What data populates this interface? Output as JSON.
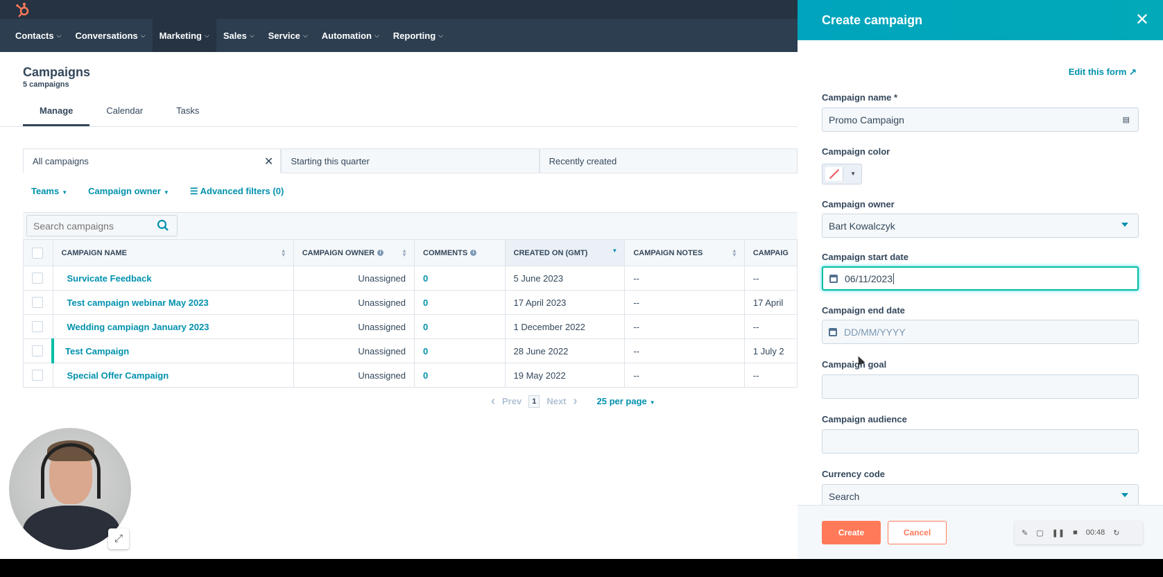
{
  "nav": {
    "items": [
      {
        "label": "Contacts"
      },
      {
        "label": "Conversations"
      },
      {
        "label": "Marketing"
      },
      {
        "label": "Sales"
      },
      {
        "label": "Service"
      },
      {
        "label": "Automation"
      },
      {
        "label": "Reporting"
      }
    ]
  },
  "header": {
    "title": "Campaigns",
    "subtitle": "5 campaigns"
  },
  "tabs": [
    {
      "label": "Manage"
    },
    {
      "label": "Calendar"
    },
    {
      "label": "Tasks"
    }
  ],
  "views": [
    {
      "label": "All campaigns"
    },
    {
      "label": "Starting this quarter"
    },
    {
      "label": "Recently created"
    }
  ],
  "filters": {
    "teams": "Teams",
    "owner": "Campaign owner",
    "advanced": "Advanced filters (0)"
  },
  "search": {
    "placeholder": "Search campaigns"
  },
  "table": {
    "headers": [
      "CAMPAIGN NAME",
      "CAMPAIGN OWNER",
      "COMMENTS",
      "CREATED ON (GMT)",
      "CAMPAIGN NOTES",
      "CAMPAIG"
    ],
    "rows": [
      {
        "name": "Survicate Feedback",
        "owner": "Unassigned",
        "comments": "0",
        "created": "5 June 2023",
        "notes": "--",
        "extra": "--"
      },
      {
        "name": "Test campaign webinar May 2023",
        "owner": "Unassigned",
        "comments": "0",
        "created": "17 April 2023",
        "notes": "--",
        "extra": "17 April"
      },
      {
        "name": "Wedding campiagn January 2023",
        "owner": "Unassigned",
        "comments": "0",
        "created": "1 December 2022",
        "notes": "--",
        "extra": "--"
      },
      {
        "name": "Test Campaign",
        "owner": "Unassigned",
        "comments": "0",
        "created": "28 June 2022",
        "notes": "--",
        "extra": "1 July 2"
      },
      {
        "name": "Special Offer Campaign",
        "owner": "Unassigned",
        "comments": "0",
        "created": "19 May 2022",
        "notes": "--",
        "extra": "--"
      }
    ]
  },
  "pagination": {
    "prev": "Prev",
    "page": "1",
    "next": "Next",
    "per_page": "25 per page"
  },
  "panel": {
    "title": "Create campaign",
    "edit_form": "Edit this form",
    "name_label": "Campaign name *",
    "name_value": "Promo Campaign",
    "color_label": "Campaign color",
    "owner_label": "Campaign owner",
    "owner_value": "Bart Kowalczyk",
    "start_label": "Campaign start date",
    "start_value": "06/11/2023",
    "end_label": "Campaign end date",
    "end_placeholder": "DD/MM/YYYY",
    "goal_label": "Campaign goal",
    "audience_label": "Campaign audience",
    "currency_label": "Currency code",
    "currency_value": "Search",
    "create": "Create",
    "cancel": "Cancel"
  },
  "recorder": {
    "time": "00:48"
  },
  "colors": {
    "nav": "#2d3e50",
    "topbar": "#253342",
    "accent": "#0091ae",
    "panel_header": "#00a4bd",
    "primary_button": "#ff7a59"
  }
}
